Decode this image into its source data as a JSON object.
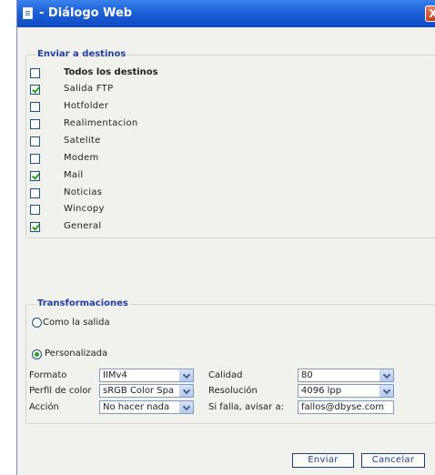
{
  "window": {
    "title": "- Diálogo Web",
    "close_label": "X"
  },
  "destinations": {
    "legend": "Enviar a destinos",
    "items": [
      {
        "label": "Todos los destinos",
        "checked": false
      },
      {
        "label": "Salida FTP",
        "checked": true
      },
      {
        "label": "Hotfolder",
        "checked": false
      },
      {
        "label": "Realimentacion",
        "checked": false
      },
      {
        "label": "Satelite",
        "checked": false
      },
      {
        "label": "Modem",
        "checked": false
      },
      {
        "label": "Mail",
        "checked": true
      },
      {
        "label": "Noticias",
        "checked": false
      },
      {
        "label": "Wincopy",
        "checked": false
      },
      {
        "label": "General",
        "checked": true
      }
    ]
  },
  "transforms": {
    "legend": "Transformaciones",
    "option_same": "Como la salida",
    "option_custom": "Personalizada",
    "selected": "Personalizada",
    "fields": {
      "formato_label": "Formato",
      "formato_value": "IIMv4",
      "perfil_label": "Perfil de color",
      "perfil_value": "sRGB Color Spa",
      "accion_label": "Acción",
      "accion_value": "No hacer nada",
      "calidad_label": "Calidad",
      "calidad_value": "80",
      "resolucion_label": "Resolución",
      "resolucion_value": "4096 lpp",
      "avisar_label": "Si falla, avisar a:",
      "avisar_value": "fallos@dbyse.com"
    }
  },
  "buttons": {
    "send": "Enviar",
    "cancel": "Cancelar"
  },
  "colors": {
    "titlebar": "#1c5fd6",
    "legend": "#1e3fa2",
    "checkmark": "#22a122",
    "dialog_bg": "#f1f1ee"
  }
}
